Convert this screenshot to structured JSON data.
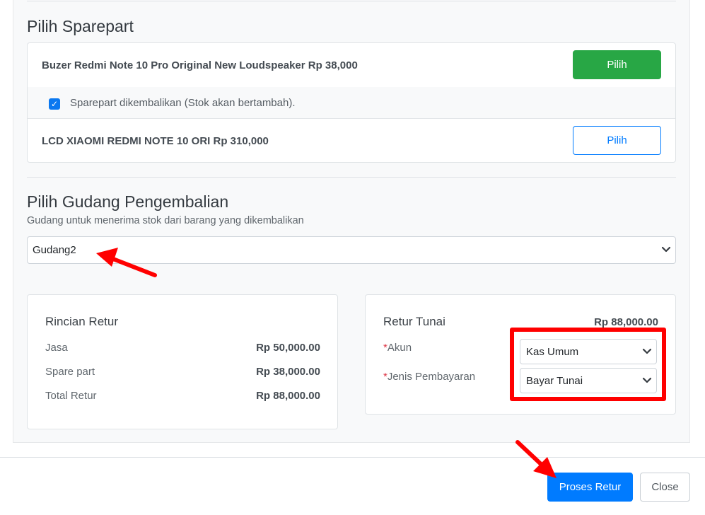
{
  "sparepart_section": {
    "title": "Pilih Sparepart",
    "items": [
      {
        "name": "Buzer Redmi Note 10 Pro Original New Loudspeaker Rp 38,000",
        "button": "Pilih"
      },
      {
        "name": "LCD XIAOMI REDMI NOTE 10 ORI Rp 310,000",
        "button": "Pilih"
      }
    ],
    "checkbox_label": "Sparepart dikembalikan (Stok akan bertambah).",
    "checkbox_checked": true
  },
  "warehouse_section": {
    "title": "Pilih Gudang Pengembalian",
    "subtitle": "Gudang untuk menerima stok dari barang yang dikembalikan",
    "selected": "Gudang2"
  },
  "rincian": {
    "title": "Rincian Retur",
    "rows": [
      {
        "label": "Jasa",
        "value": "Rp 50,000.00"
      },
      {
        "label": "Spare part",
        "value": "Rp 38,000.00"
      },
      {
        "label": "Total Retur",
        "value": "Rp 88,000.00"
      }
    ]
  },
  "retur_tunai": {
    "title": "Retur Tunai",
    "amount": "Rp 88,000.00",
    "required_mark": "*",
    "akun_label": "Akun",
    "akun_value": "Kas Umum",
    "jenis_label": "Jenis Pembayaran",
    "jenis_value": "Bayar Tunai"
  },
  "footer": {
    "proses_label": "Proses Retur",
    "close_label": "Close"
  },
  "colors": {
    "primary": "#007bff",
    "success": "#28a745",
    "annotation_red": "#ff0000",
    "required": "#dc3545"
  },
  "icons": [
    "chevron-down-icon",
    "check-icon",
    "annotation-arrow"
  ]
}
